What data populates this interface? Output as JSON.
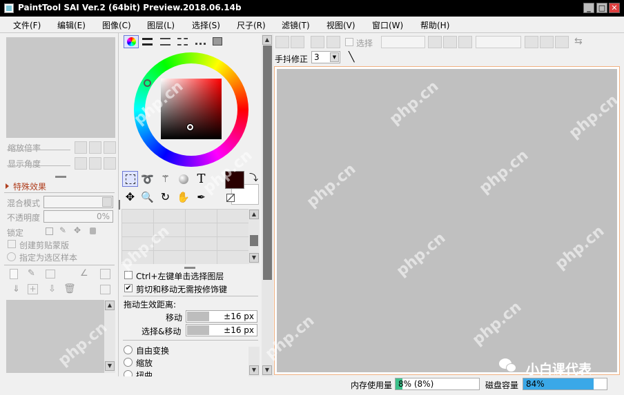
{
  "titlebar": {
    "title": "PaintTool SAI Ver.2 (64bit) Preview.2018.06.14b",
    "min": "_",
    "max": "□",
    "close": "✕"
  },
  "menu": [
    "文件(F)",
    "编辑(E)",
    "图像(C)",
    "图层(L)",
    "选择(S)",
    "尺子(R)",
    "滤镜(T)",
    "视图(V)",
    "窗口(W)",
    "帮助(H)"
  ],
  "nav": {
    "zoom_label": "缩放倍率",
    "angle_label": "显示角度"
  },
  "layer_panel": {
    "effects_label": "特殊效果",
    "blend_label": "混合模式",
    "opacity_label": "不透明度",
    "opacity_value": "0%",
    "lock_label": "锁定",
    "clip_label": "创建剪贴蒙版",
    "sample_label": "指定为选区样本"
  },
  "tool_options": {
    "ctrl_select": "Ctrl+左键单击选择图层",
    "cut_move": "剪切和移动无需按修饰键",
    "drag_distance": "拖动生效距离:",
    "move_label": "移动",
    "move_value": "±16 px",
    "select_move_label": "选择&移动",
    "select_move_value": "±16 px",
    "free_transform": "自由变换",
    "scale": "缩放",
    "distort": "扭曲"
  },
  "canvas_toolbar": {
    "select_label": "选择",
    "stabilizer_label": "手抖修正",
    "stabilizer_value": "3"
  },
  "statusbar": {
    "memory_label": "内存使用量",
    "memory_value": "8% (8%)",
    "memory_percent": 8,
    "disk_label": "磁盘容量",
    "disk_value": "84%",
    "disk_percent": 84
  },
  "colors": {
    "primary": "#2a0000",
    "canvas_bg": "#c0c0c0",
    "canvas_border": "#f0b080"
  },
  "watermark": {
    "text": "php.cn",
    "brand": "小白课代表"
  }
}
